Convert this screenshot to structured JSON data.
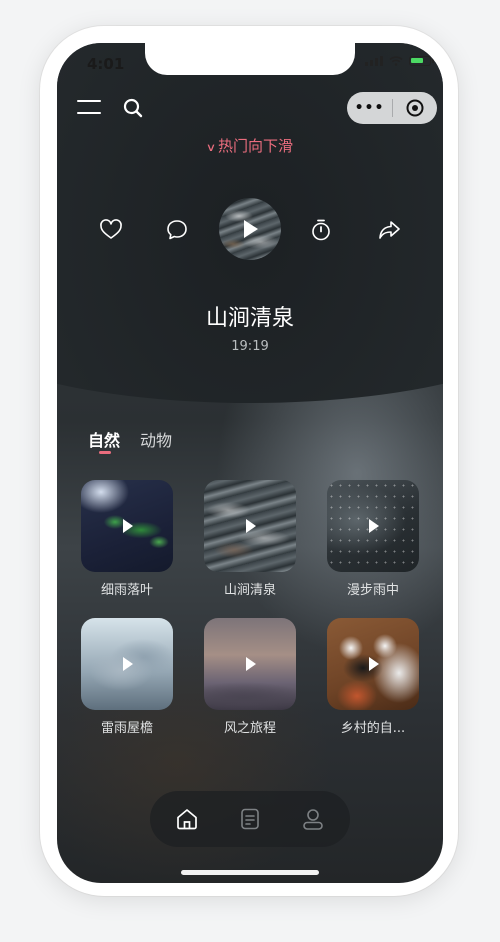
{
  "status_bar": {
    "time": "4:01"
  },
  "header": {
    "hot_tip": "热门向下滑"
  },
  "now_playing": {
    "title": "山涧清泉",
    "duration": "19:19"
  },
  "tabs": [
    {
      "label": "自然",
      "active": true
    },
    {
      "label": "动物",
      "active": false
    }
  ],
  "cards": [
    {
      "label": "细雨落叶"
    },
    {
      "label": "山涧清泉"
    },
    {
      "label": "漫步雨中"
    },
    {
      "label": "雷雨屋檐"
    },
    {
      "label": "风之旅程"
    },
    {
      "label": "乡村的自..."
    }
  ],
  "tab_bar": [
    {
      "icon": "home-icon",
      "active": true
    },
    {
      "icon": "document-icon",
      "active": false
    },
    {
      "icon": "user-icon",
      "active": false
    }
  ],
  "colors": {
    "accent": "#ea6d7e",
    "text_primary": "#ffffff",
    "text_secondary": "#b9bdbf"
  }
}
